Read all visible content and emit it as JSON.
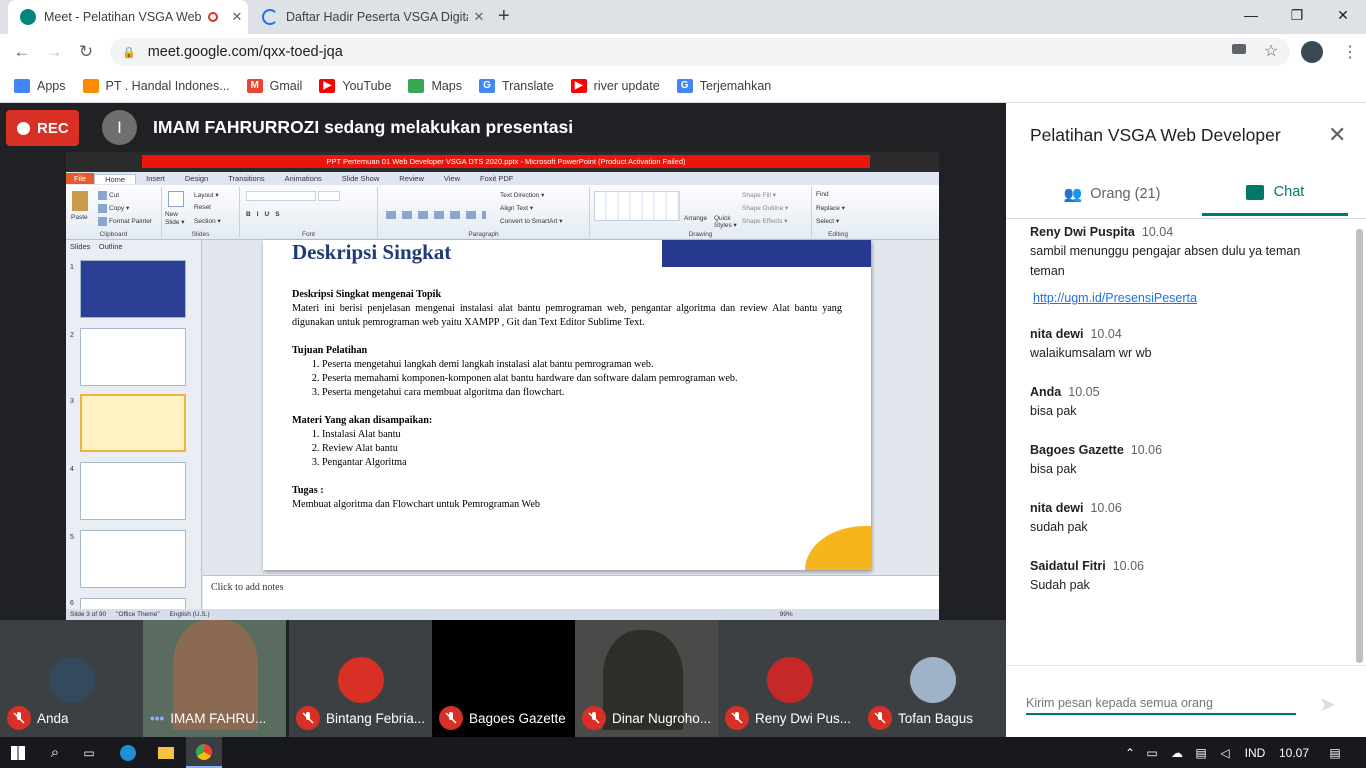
{
  "browser": {
    "tabs": [
      {
        "title": "Meet - Pelatihan VSGA Web",
        "close": "✕",
        "active": true
      },
      {
        "title": "Daftar Hadir Peserta VSGA Digita",
        "close": "✕",
        "active": false
      }
    ],
    "new_tab": "+",
    "window": {
      "minimize": "—",
      "restore": "❐",
      "close": "✕"
    },
    "url": "meet.google.com/qxx-toed-jqa",
    "bookmarks": [
      "Apps",
      "PT . Handal Indones...",
      "Gmail",
      "YouTube",
      "Maps",
      "Translate",
      "river update",
      "Terjemahkan"
    ]
  },
  "meet": {
    "rec_label": "REC",
    "presenter_initial": "I",
    "presenter_text": "IMAM FAHRURROZI sedang melakukan presentasi",
    "participants": [
      {
        "name": "Anda",
        "muted": true
      },
      {
        "name": "IMAM FAHRU...",
        "muted": false
      },
      {
        "name": "Bintang Febria...",
        "muted": true
      },
      {
        "name": "Bagoes Gazette",
        "muted": true
      },
      {
        "name": "Dinar Nugroho...",
        "muted": true
      },
      {
        "name": "Reny Dwi Pus...",
        "muted": true
      },
      {
        "name": "Tofan Bagus",
        "muted": true
      }
    ]
  },
  "ppt": {
    "window_title": "PPT Pertemuan 01 Web Developer VSGA DTS 2020.pptx  -  Microsoft PowerPoint (Product Activation Failed)",
    "menu_tabs": [
      "File",
      "Home",
      "Insert",
      "Design",
      "Transitions",
      "Animations",
      "Slide Show",
      "Review",
      "View",
      "Foxit PDF"
    ],
    "ribbon": {
      "paste": "Paste",
      "cut": "Cut",
      "copy": "Copy ▾",
      "format_painter": "Format Painter",
      "new_slide": "New Slide ▾",
      "layout": "Layout ▾",
      "reset": "Reset",
      "section": "Section ▾",
      "text_direction": "Text Direction ▾",
      "align_text": "Align Text ▾",
      "smartart": "Convert to SmartArt ▾",
      "arrange": "Arrange",
      "quick_styles": "Quick Styles ▾",
      "shape_fill": "Shape Fill ▾",
      "shape_outline": "Shape Outline ▾",
      "shape_effects": "Shape Effects ▾",
      "find": "Find",
      "replace": "Replace ▾",
      "select": "Select ▾",
      "groups": [
        "Clipboard",
        "Slides",
        "Font",
        "Paragraph",
        "Drawing",
        "Editing"
      ]
    },
    "panel_tabs": [
      "Slides",
      "Outline"
    ],
    "thumb_numbers": [
      "1",
      "2",
      "3",
      "4",
      "5",
      "6"
    ],
    "slide": {
      "title": "Deskripsi Singkat",
      "heading1": "Deskripsi Singkat mengenai Topik",
      "desc": "Materi ini berisi penjelasan mengenai instalasi alat bantu pemrograman web, pengantar algoritma dan review Alat bantu yang digunakan untuk pemrograman web yaitu XAMPP , Git dan Text Editor Sublime Text.",
      "heading2": "Tujuan Pelatihan",
      "goals": [
        "Peserta mengetahui langkah demi langkah instalasi alat bantu pemrograman web.",
        "Peserta memahami komponen-komponen alat bantu hardware dan software dalam pemrograman web.",
        "Peserta mengetahui cara membuat algoritma dan flowchart."
      ],
      "heading3": "Materi Yang akan disampaikan:",
      "materials": [
        "Instalasi Alat bantu",
        "Review Alat bantu",
        "Pengantar Algoritma"
      ],
      "heading4": "Tugas :",
      "task": "Membuat algoritma dan Flowchart untuk Pemrograman Web"
    },
    "notes": "Click to add notes",
    "status": [
      "Slide 3 of 90",
      "\"Office Theme\"",
      "English (U.S.)"
    ],
    "zoom": "99%"
  },
  "chat": {
    "title": "Pelatihan VSGA Web Developer",
    "tab_people": "Orang (21)",
    "tab_chat": "Chat",
    "messages": [
      {
        "sender": "Reny Dwi Puspita",
        "time": "10.04",
        "text": "sambil menunggu pengajar absen dulu ya teman teman",
        "link": "http://ugm.id/PresensiPeserta"
      },
      {
        "sender": "nita dewi",
        "time": "10.04",
        "text": "walaikumsalam wr wb"
      },
      {
        "sender": "Anda",
        "time": "10.05",
        "text": "bisa pak"
      },
      {
        "sender": "Bagoes Gazette",
        "time": "10.06",
        "text": "bisa pak"
      },
      {
        "sender": "nita dewi",
        "time": "10.06",
        "text": "sudah pak"
      },
      {
        "sender": "Saidatul Fitri",
        "time": "10.06",
        "text": "Sudah pak"
      }
    ],
    "input_placeholder": "Kirim pesan kepada semua orang"
  },
  "taskbar": {
    "language": "IND",
    "clock": "10.07"
  }
}
